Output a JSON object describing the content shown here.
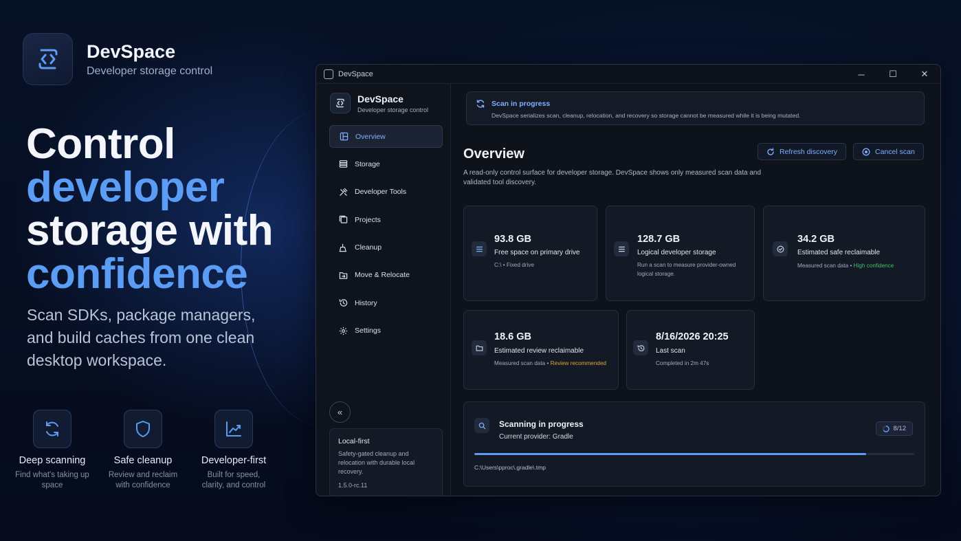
{
  "brand": {
    "name": "DevSpace",
    "subtitle": "Developer storage control"
  },
  "hero": {
    "line1": "Control",
    "line2": "developer",
    "line3": "storage with",
    "line4": "confidence",
    "subtitle": "Scan SDKs, package managers, and build caches from one clean desktop workspace."
  },
  "features": [
    {
      "icon": "refresh-icon",
      "title": "Deep scanning",
      "desc": "Find what's taking up space"
    },
    {
      "icon": "shield-icon",
      "title": "Safe cleanup",
      "desc": "Review and reclaim with confidence"
    },
    {
      "icon": "chart-icon",
      "title": "Developer-first",
      "desc": "Built for speed, clarity, and control"
    }
  ],
  "window": {
    "title": "DevSpace",
    "controls": {
      "minimize": "─",
      "maximize": "☐",
      "close": "✕"
    }
  },
  "sidebar": {
    "name": "DevSpace",
    "subtitle": "Developer storage control",
    "items": [
      {
        "label": "Overview",
        "icon": "overview-icon",
        "active": true
      },
      {
        "label": "Storage",
        "icon": "storage-icon",
        "active": false
      },
      {
        "label": "Developer Tools",
        "icon": "tools-icon",
        "active": false
      },
      {
        "label": "Projects",
        "icon": "projects-icon",
        "active": false
      },
      {
        "label": "Cleanup",
        "icon": "cleanup-icon",
        "active": false
      },
      {
        "label": "Move & Relocate",
        "icon": "move-icon",
        "active": false
      },
      {
        "label": "History",
        "icon": "history-icon",
        "active": false
      },
      {
        "label": "Settings",
        "icon": "settings-icon",
        "active": false
      }
    ],
    "collapse_glyph": "«",
    "local_card": {
      "title": "Local-first",
      "desc": "Safety-gated cleanup and relocation with durable local recovery.",
      "version": "1.5.0-rc.11"
    }
  },
  "banner": {
    "title": "Scan in progress",
    "desc": "DevSpace serializes scan, cleanup, relocation, and recovery so storage cannot be measured while it is being mutated."
  },
  "overview": {
    "title": "Overview",
    "desc": "A read-only control surface for developer storage. DevSpace shows only measured scan data and validated tool discovery.",
    "refresh_label": "Refresh discovery",
    "cancel_label": "Cancel scan"
  },
  "cards": {
    "free_space": {
      "value": "93.8 GB",
      "label": "Free space on primary drive",
      "meta": "C:\\ • Fixed drive"
    },
    "logical": {
      "value": "128.7 GB",
      "label": "Logical developer storage",
      "meta": "Run a scan to measure provider-owned logical storage."
    },
    "safe": {
      "value": "34.2 GB",
      "label": "Estimated safe reclaimable",
      "meta_prefix": "Measured scan data • ",
      "meta_status": "High confidence"
    },
    "review": {
      "value": "18.6 GB",
      "label": "Estimated review reclaimable",
      "meta_prefix": "Measured scan data • ",
      "meta_status": "Review recommended"
    },
    "last_scan": {
      "value": "8/16/2026 20:25",
      "label": "Last scan",
      "meta": "Completed in 2m 47s"
    }
  },
  "scan": {
    "title": "Scanning in progress",
    "provider": "Current provider: Gradle",
    "count": "8/12",
    "progress": 0.89,
    "path": "C:\\Users\\pproc\\.gradle\\.tmp"
  },
  "colors": {
    "accent": "#5b9cf5",
    "link": "#7fb0ff",
    "success": "#3fbf6e",
    "warning": "#e0a531"
  }
}
